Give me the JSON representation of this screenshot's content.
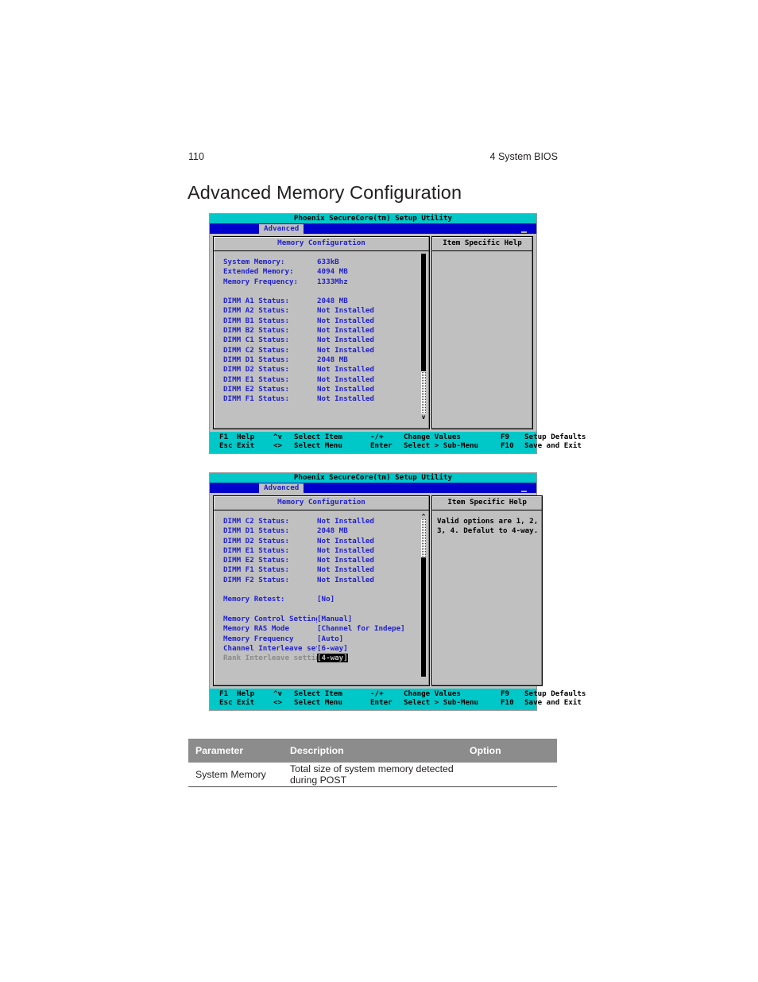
{
  "page": {
    "number": "110",
    "chapter": "4 System BIOS",
    "heading": "Advanced Memory Configuration"
  },
  "bios": {
    "title": "Phoenix SecureCore(tm) Setup Utility",
    "tab": "Advanced",
    "panel_main_title": "Memory Configuration",
    "panel_help_title": "Item Specific Help",
    "footer": {
      "line1": {
        "k1": "F1",
        "w1": "Help",
        "s1": "^v",
        "w2": "Select Item",
        "s2": "-/+",
        "w3": "Change Values",
        "k2": "F9",
        "w4": "Setup Defaults"
      },
      "line2": {
        "k1": "Esc",
        "w1": "Exit",
        "s1": "<>",
        "w2": "Select Menu",
        "s2": "Enter",
        "w3": "Select > Sub-Menu",
        "k2": "F10",
        "w4": "Save and Exit"
      }
    }
  },
  "screen1": {
    "summary": [
      {
        "label": "System Memory:",
        "value": "633kB"
      },
      {
        "label": "Extended Memory:",
        "value": "4094 MB"
      },
      {
        "label": "Memory Frequency:",
        "value": "1333Mhz"
      }
    ],
    "dimms": [
      {
        "label": "DIMM A1 Status:",
        "value": "2048 MB"
      },
      {
        "label": "DIMM A2 Status:",
        "value": "Not Installed"
      },
      {
        "label": "DIMM B1 Status:",
        "value": "Not Installed"
      },
      {
        "label": "DIMM B2 Status:",
        "value": "Not Installed"
      },
      {
        "label": "DIMM C1 Status:",
        "value": "Not Installed"
      },
      {
        "label": "DIMM C2 Status:",
        "value": "Not Installed"
      },
      {
        "label": "DIMM D1 Status:",
        "value": "2048 MB"
      },
      {
        "label": "DIMM D2 Status:",
        "value": "Not Installed"
      },
      {
        "label": "DIMM E1 Status:",
        "value": "Not Installed"
      },
      {
        "label": "DIMM E2 Status:",
        "value": "Not Installed"
      },
      {
        "label": "DIMM F1 Status:",
        "value": "Not Installed"
      }
    ],
    "scroll_down_arrow": "v",
    "help_text": ""
  },
  "screen2": {
    "dimms": [
      {
        "label": "DIMM C2 Status:",
        "value": "Not Installed"
      },
      {
        "label": "DIMM D1 Status:",
        "value": "2048 MB"
      },
      {
        "label": "DIMM D2 Status:",
        "value": "Not Installed"
      },
      {
        "label": "DIMM E1 Status:",
        "value": "Not Installed"
      },
      {
        "label": "DIMM E2 Status:",
        "value": "Not Installed"
      },
      {
        "label": "DIMM F1 Status:",
        "value": "Not Installed"
      },
      {
        "label": "DIMM F2 Status:",
        "value": "Not Installed"
      }
    ],
    "retest": {
      "label": "Memory Retest:",
      "value": "[No]"
    },
    "settings": [
      {
        "label": "Memory Control Settings",
        "value": "[Manual]",
        "selected": false
      },
      {
        "label": "Memory RAS Mode",
        "value": "[Channel for Indepe]",
        "selected": false
      },
      {
        "label": "Memory Frequency",
        "value": "[Auto]",
        "selected": false
      },
      {
        "label": "Channel Interleave setting",
        "value": "[6-way]",
        "selected": false
      },
      {
        "label": "Rank Interleave setting",
        "value": "[4-way]",
        "selected": true
      }
    ],
    "scroll_up_arrow": "^",
    "help_line1": "Valid options are 1, 2,",
    "help_line2": "3, 4. Defalut to 4-way."
  },
  "ref_table": {
    "headers": {
      "parameter": "Parameter",
      "description": "Description",
      "option": "Option"
    },
    "rows": [
      {
        "parameter": "System Memory",
        "description": "Total size of system memory detected during POST",
        "option": ""
      }
    ]
  }
}
